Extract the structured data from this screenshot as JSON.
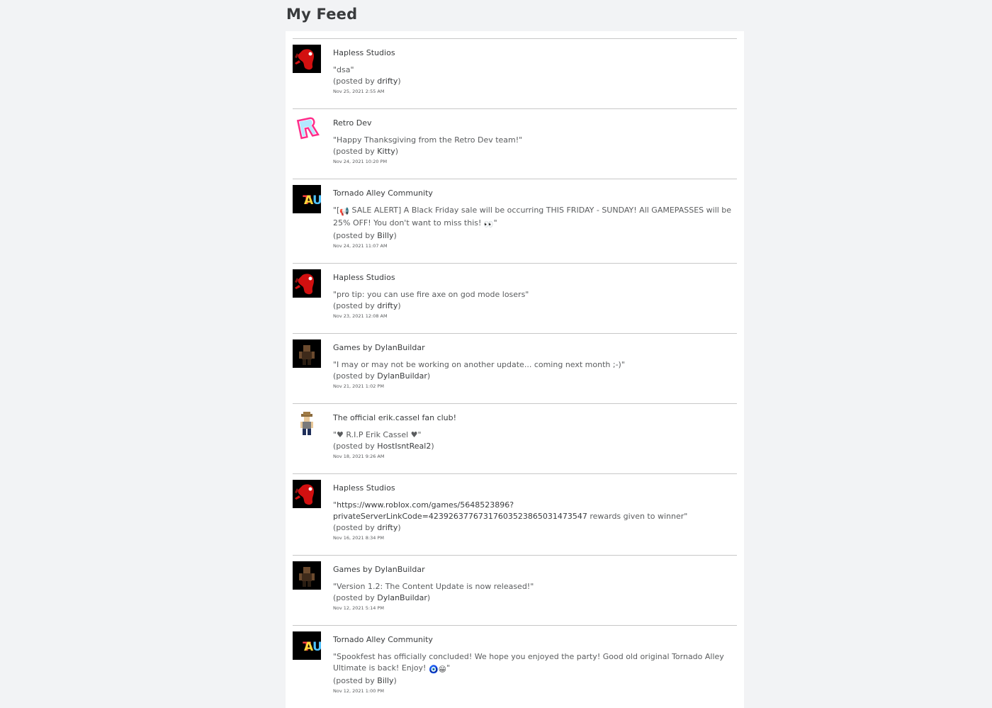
{
  "title": "My Feed",
  "feed": [
    {
      "group": "Hapless Studios",
      "avatar": "hapless-logo",
      "text_open": "\"dsa\"",
      "posted_prefix": "(posted by ",
      "poster": "drifty",
      "posted_suffix": ")",
      "date": "Nov 25, 2021 2:55 AM"
    },
    {
      "group": "Retro Dev",
      "avatar": "retro-dev-logo",
      "text_open": "\"Happy Thanksgiving from the Retro Dev team!\"",
      "posted_prefix": "(posted by ",
      "poster": "Kitty",
      "posted_suffix": ")",
      "date": "Nov 24, 2021 10:20 PM"
    },
    {
      "group": "Tornado Alley Community",
      "avatar": "tau-logo",
      "text_open": "\"[",
      "text_mid": "📢",
      "text_rest": " SALE ALERT] A Black Friday sale will be occurring THIS FRIDAY - SUNDAY! All GAMEPASSES will be 25% OFF! You don't want to miss this! ",
      "text_emoji": "👀",
      "text_close": "\"",
      "posted_prefix": "(posted by ",
      "poster": "Billy",
      "posted_suffix": ")",
      "date": "Nov 24, 2021 11:07 AM"
    },
    {
      "group": "Hapless Studios",
      "avatar": "hapless-logo",
      "text_open": "\"pro tip: you can use fire axe on god mode losers\"",
      "posted_prefix": "(posted by ",
      "poster": "drifty",
      "posted_suffix": ")",
      "date": "Nov 23, 2021 12:08 AM"
    },
    {
      "group": "Games by DylanBuildar",
      "avatar": "dylan-logo",
      "text_open": "\"I may or may not be working on another update... coming next month ;-)\"",
      "posted_prefix": "(posted by ",
      "poster": "DylanBuildar",
      "posted_suffix": ")",
      "date": "Nov 21, 2021 1:02 PM"
    },
    {
      "group": "The official erik.cassel fan club!",
      "avatar": "erik-avatar",
      "text_open": "\"♥ R.I.P Erik Cassel ♥\"",
      "posted_prefix": "(posted by ",
      "poster": "HostIsntReal2",
      "posted_suffix": ")",
      "date": "Nov 18, 2021 9:26 AM"
    },
    {
      "group": "Hapless Studios",
      "avatar": "hapless-logo",
      "text_open": "\"",
      "link": "https://www.roblox.com/games/5648523896?privateServerLinkCode=42392637767317603523865031473547",
      "text_rest": " rewards given to winner\"",
      "posted_prefix": "(posted by ",
      "poster": "drifty",
      "posted_suffix": ")",
      "date": "Nov 16, 2021 8:34 PM"
    },
    {
      "group": "Games by DylanBuildar",
      "avatar": "dylan-logo",
      "text_open": "\"Version 1.2: The Content Update is now released!\"",
      "posted_prefix": "(posted by ",
      "poster": "DylanBuildar",
      "posted_suffix": ")",
      "date": "Nov 12, 2021 5:14 PM"
    },
    {
      "group": "Tornado Alley Community",
      "avatar": "tau-logo",
      "text_open": "\"Spookfest has officially concluded! We hope you enjoyed the party! Good old original Tornado Alley Ultimate is back! Enjoy! ",
      "text_emoji": "🧿😁",
      "text_close": "\"",
      "posted_prefix": "(posted by ",
      "poster": "Billy",
      "posted_suffix": ")",
      "date": "Nov 12, 2021 1:00 PM"
    }
  ]
}
